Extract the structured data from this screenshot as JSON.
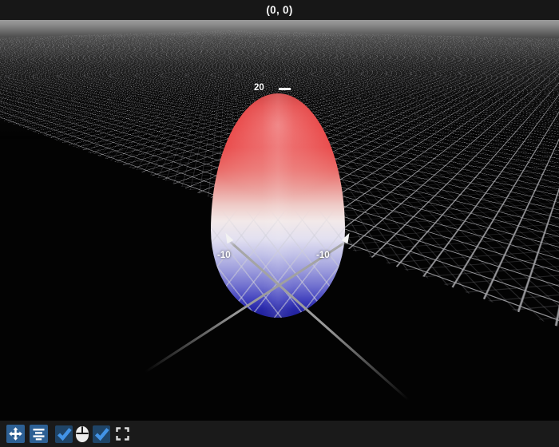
{
  "titlebar": {
    "title": "(0, 0)"
  },
  "viewport": {
    "z_axis_tick": "20",
    "axis_tick_left": "-10",
    "axis_tick_right": "-10",
    "surface_colors": {
      "top": "#e02020",
      "middle": "#f2eeee",
      "bottom": "#2525b0"
    },
    "grid_line_color": "#9b9b9b",
    "background_color": "#000000",
    "label_color": "#ffffff"
  },
  "toolbar": {
    "background_color": "#1a1a1a",
    "button_color": "#2d6094",
    "checkbox_fill_color": "#1f4467",
    "check_color": "#4293e6",
    "items": [
      {
        "name": "move",
        "icon": "move-arrows-icon"
      },
      {
        "name": "center-bars",
        "icon": "center-bars-icon"
      },
      {
        "name": "checkbox-1",
        "icon": "checkmark-icon",
        "checked": true
      },
      {
        "name": "mouse",
        "icon": "mouse-icon"
      },
      {
        "name": "checkbox-2",
        "icon": "checkmark-icon",
        "checked": true
      },
      {
        "name": "fullscreen",
        "icon": "fullscreen-icon"
      }
    ]
  }
}
